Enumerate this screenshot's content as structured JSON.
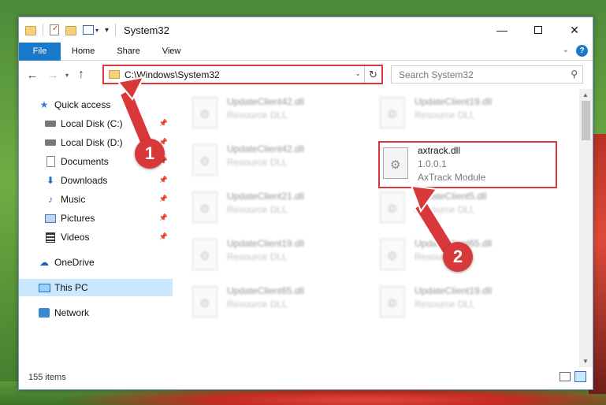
{
  "window": {
    "title": "System32",
    "controls": {
      "minimize": "—",
      "close": "✕"
    }
  },
  "ribbon": {
    "file_tab": "File",
    "tabs": [
      "Home",
      "Share",
      "View"
    ]
  },
  "address_bar": {
    "path": "C:\\Windows\\System32",
    "search_placeholder": "Search System32"
  },
  "nav_pane": {
    "items": [
      {
        "label": "Quick access",
        "icon": "star-icon",
        "pinned": false
      },
      {
        "label": "Local Disk (C:)",
        "icon": "drive-icon",
        "pinned": true
      },
      {
        "label": "Local Disk (D:)",
        "icon": "drive-icon",
        "pinned": true
      },
      {
        "label": "Documents",
        "icon": "document-icon",
        "pinned": true
      },
      {
        "label": "Downloads",
        "icon": "download-icon",
        "pinned": true
      },
      {
        "label": "Music",
        "icon": "music-icon",
        "pinned": true
      },
      {
        "label": "Pictures",
        "icon": "pictures-icon",
        "pinned": true
      },
      {
        "label": "Videos",
        "icon": "video-icon",
        "pinned": true
      },
      {
        "label": "OneDrive",
        "icon": "cloud-icon",
        "pinned": false
      },
      {
        "label": "This PC",
        "icon": "computer-icon",
        "pinned": false,
        "selected": true
      },
      {
        "label": "Network",
        "icon": "network-icon",
        "pinned": false
      }
    ]
  },
  "files": {
    "left_column": [
      {
        "name": "UpdateClient42.dll",
        "type": "Resource DLL"
      },
      {
        "name": "UpdateClient42.dll",
        "type": "Resource DLL"
      },
      {
        "name": "UpdateClient21.dll",
        "type": "Resource DLL"
      },
      {
        "name": "UpdateClient19.dll",
        "type": "Resource DLL"
      },
      {
        "name": "UpdateClient65.dll",
        "type": "Resource DLL"
      }
    ],
    "right_column": [
      {
        "name": "UpdateClient19.dll",
        "type": "Resource DLL"
      },
      {
        "name": "axtrack.dll",
        "version": "1.0.0.1",
        "type": "AxTrack Module",
        "highlighted": true
      },
      {
        "name": "UpdateClient5.dll",
        "type": "Resource DLL"
      },
      {
        "name": "UpdateClient65.dll",
        "type": "Resource DLL"
      },
      {
        "name": "UpdateClient19.dll",
        "type": "Resource DLL"
      }
    ]
  },
  "status_bar": {
    "item_count": "155 items"
  },
  "annotations": {
    "marker_1": "1",
    "marker_2": "2",
    "color": "#d9383a"
  }
}
